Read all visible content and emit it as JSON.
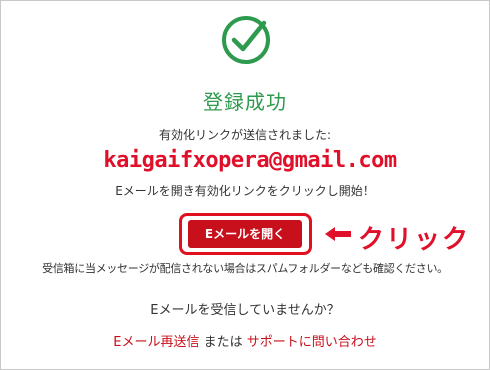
{
  "success": {
    "icon": "check-circle-icon",
    "title": "登録成功",
    "sent_text": "有効化リンクが送信されました:",
    "email": "kaigaifxopera@gmail.com",
    "instruction": "Eメールを開き有効化リンクをクリックし開始！",
    "open_email_button": "Eメールを開く",
    "annotation_arrow_icon": "left-arrow-icon",
    "annotation_text": "クリック",
    "spam_note": "受信箱に当メッセージが配信されない場合はスパムフォルダーなども確認ください。",
    "not_received": "Eメールを受信していませんか？",
    "resend_link": "Eメール再送信",
    "or_text": " または ",
    "support_link": "サポートに問い合わせ"
  },
  "colors": {
    "success_green": "#2e9a4e",
    "brand_red": "#c8101c",
    "annotation_red": "#e0102a"
  }
}
